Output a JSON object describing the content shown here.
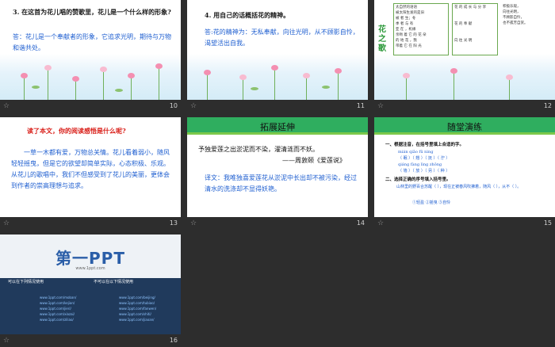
{
  "slides": [
    {
      "number": "10",
      "question": "3. 在这首为花儿唱的赞歌里，花儿是一个什么样的形象?",
      "answer": "答：花儿是一个奉献者的形象，它追求光明，期待与万物和谐共处。"
    },
    {
      "number": "11",
      "question": "4. 用自己的话概括花的精神。",
      "answer": "答:花的精神为：无私奉献，向往光明，从不顾影自怜，渴望活出自我。"
    },
    {
      "number": "12",
      "side_title": "花之歌",
      "col1": [
        "太自然的语语",
        "被太阳生发的是旧",
        "被 者 生；冬",
        "季 者 与 有",
        "亚 在 ，机缘",
        "亲吻 着 它 的 花 朵",
        "的 地 花 ，我",
        "带着 它 在 阳 光"
      ],
      "col2": [
        "花 的 成 长 与 分 享",
        "花 的 奉 献",
        "向 往 光 明"
      ],
      "col3": [
        "积极乐观，",
        "向往光明，",
        "不顾影自怜，",
        "也不孤芳自赏。"
      ]
    },
    {
      "number": "13",
      "prompt": "读了本文，你的阅读感悟是什么呢?",
      "body": "一草一木都有爱，万物总关情。花儿看着弱小，随风轻轻摇曳，但是它的欲望却简单实际，心态积极、乐观。从花儿的歌唱中，我们不但感受到了花儿的美丽，更体会到作者的崇高理想与追求。"
    },
    {
      "number": "14",
      "title": "拓展延伸",
      "quote": "予独爱莲之出淤泥而不染，濯清涟而不妖。",
      "source": "——周敦颐《爱莲说》",
      "translation": "译文：我唯独喜爱莲花从淤泥中长出却不被污染，经过清水的洗涤却不显得妖艳。"
    },
    {
      "number": "15",
      "title": "随堂演练",
      "task1": "一、根据注音，在括号里填上合适的字。",
      "pinyin_rows": [
        "mián  qiǎo  fǔ  nìng",
        "（ 眠 ）（ 翘 ）（ 抚 ）（ 泞 ）",
        "qiáng  fàng  lìng  zhǒng",
        "（ 墙 ）（ 放 ）（ 另 ）（ 种 ）"
      ],
      "task2": "二、选择正确的序号填入括号里。",
      "sentence": "山林里的野百合苏醒（  ），现在正被春风吹拂着，随风（  ），从不（  ）。",
      "options": "①轻盈 ②摇曳 ③自怜"
    },
    {
      "number": "16",
      "logo": "第一PPT",
      "site": "www.1ppt.com",
      "left_heading": "可以在下列情况使用",
      "right_heading": "不可以在以下情况使用",
      "left_links": [
        "www.1ppt.com/moban/",
        "www.1ppt.com/kejian/",
        "www.1ppt.com/jieri/",
        "www.1ppt.com/xiazai/",
        "www.1ppt.com/ziliao/"
      ],
      "right_links": [
        "www.1ppt.com/beijing/",
        "www.1ppt.com/tubiao/",
        "www.1ppt.com/fanwen/",
        "www.1ppt.com/shiti/",
        "www.1ppt.com/jiaoan/"
      ]
    }
  ],
  "colors": {
    "background": "#2d2d2d",
    "answer_blue": "#1f5fd0",
    "accent_green": "#2fae5f",
    "prompt_red": "#d91e18"
  }
}
